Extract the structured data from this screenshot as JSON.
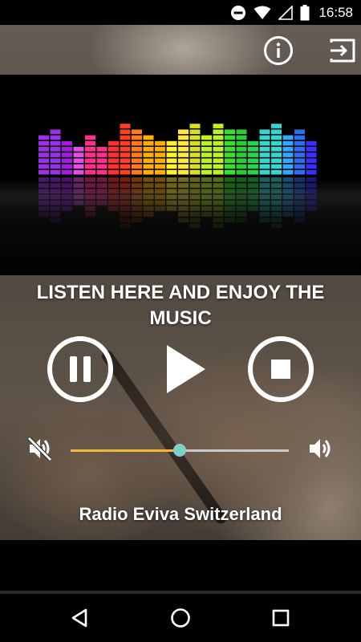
{
  "status_bar": {
    "time": "16:58",
    "icons": [
      "do-not-disturb-icon",
      "wifi-icon",
      "signal-icon",
      "battery-icon"
    ]
  },
  "header": {
    "icons": [
      "info-icon",
      "exit-icon"
    ]
  },
  "player": {
    "title": "LISTEN HERE AND ENJOY THE MUSIC",
    "controls": [
      "pause-icon",
      "play-icon",
      "stop-icon"
    ],
    "station_name": "Radio Eviva Switzerland"
  },
  "volume": {
    "level": 0.5,
    "left_icon": "volume-mute-icon",
    "right_icon": "volume-up-icon",
    "fill_color": "#f3b73a",
    "thumb_color": "#7fd0c4"
  },
  "nav_bar": {
    "icons": [
      "back-icon",
      "home-icon",
      "recents-icon"
    ]
  },
  "equalizer_colors": [
    "#9b30e6",
    "#a21de0",
    "#e44ee8",
    "#ff2f8e",
    "#ff3030",
    "#ff3e22",
    "#ff7a1a",
    "#ffb000",
    "#fff227",
    "#ffe83a",
    "#d9e020",
    "#bff21f",
    "#36e02c",
    "#2ccb3a",
    "#27d64a",
    "#34d6d0",
    "#34a8ff",
    "#2f6df0",
    "#3a2fff"
  ]
}
